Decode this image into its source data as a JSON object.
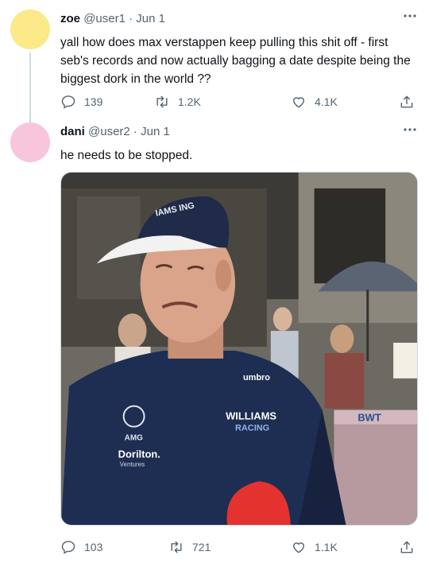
{
  "tweets": [
    {
      "display_name": "zoe",
      "handle": "@user1",
      "date": "Jun 1",
      "avatar_color": "#fbe98a",
      "text": "yall how does max verstappen keep pulling this shit off - first seb's records and now actually bagging a date despite being the biggest dork in the world ??",
      "replies": "139",
      "retweets": "1.2K",
      "likes": "4.1K"
    },
    {
      "display_name": "dani",
      "handle": "@user2",
      "date": "Jun 1",
      "avatar_color": "#f7c6dc",
      "text": "he needs to be stopped.",
      "replies": "103",
      "retweets": "721",
      "likes": "1.1K",
      "media": {
        "cap_text": "IAMS ING",
        "shirt_brand": "umbro",
        "shirt_team_line1": "WILLIAMS",
        "shirt_team_line2": "RACING",
        "shirt_sponsor": "AMG",
        "shirt_sponsor2": "Dorilton.",
        "shirt_sponsor2_sub": "Ventures",
        "banner_text": "BWT"
      }
    }
  ],
  "icons": [
    "more-icon",
    "reply-icon",
    "retweet-icon",
    "like-icon",
    "share-icon"
  ],
  "colors": {
    "secondary_text": "#536471",
    "thread_line": "#cfd9de"
  }
}
